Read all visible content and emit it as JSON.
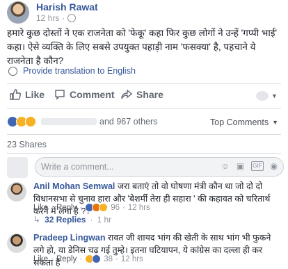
{
  "post": {
    "author": "Harish Rawat",
    "time": "12 hrs",
    "text": "हमारे कुछ दोस्तों ने एक राजनेता को 'फेकू' कहा फिर कुछ लोगों ने उन्हें 'गप्पी भाई' कहा। ऐसे व्यक्ति के लिए सबसे उपयुक्त पहाड़ी नाम 'फसक्या' है, पहचाने ये राजनेता है कौन?",
    "translate": "Provide translation to English"
  },
  "actions": {
    "like": "Like",
    "comment": "Comment",
    "share": "Share"
  },
  "reactions": {
    "others": "and 967 others",
    "sort": "Top Comments"
  },
  "shares": "23 Shares",
  "composer": {
    "placeholder": "Write a comment..."
  },
  "comments": [
    {
      "author": "Anil Mohan Semwal",
      "text": "जरा बताएं तो वो घोषणा मंत्री कौन था जो दो दो विधानसभा से चुनाव हारा और 'बेशर्मी तेरा ही सहारा ' की कहावत को चरितार्थ करने में लगा है ??",
      "like": "Like",
      "reply": "Reply",
      "count": "96",
      "time": "12 hrs",
      "replies": "32 Replies",
      "replies_time": "1 hr"
    },
    {
      "author": "Pradeep Lingwan",
      "text": "रावत जी शायद भांग की खेती के साथ भांग भी फुकने लगे हो, या डेनिस चढ़ गई तुम्हे। इतना घटियापन, ये कांग्रेस का दल्ला ही कर सकता है",
      "like": "Like",
      "reply": "Reply",
      "count": "38",
      "time": "12 hrs"
    }
  ],
  "colors": {
    "link": "#365899",
    "meta": "#90949c",
    "like_blue": "#4267b2",
    "haha_yellow": "#f7b125",
    "love_red": "#f25268"
  },
  "icons": [
    "translate-globe-icon",
    "like-thumb-icon",
    "comment-bubble-icon",
    "share-arrow-icon",
    "chevron-down-icon",
    "emoji-icon",
    "camera-icon",
    "gif-icon",
    "sticker-icon",
    "reply-arrow-icon"
  ]
}
